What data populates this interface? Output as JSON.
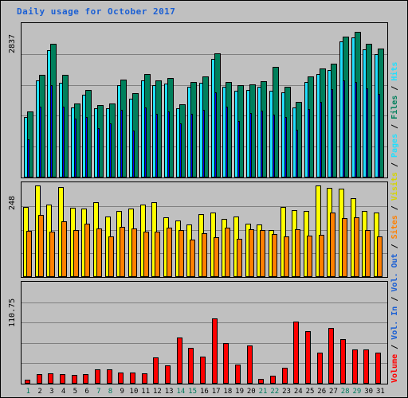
{
  "title": "Daily usage for October 2017",
  "colors": {
    "title": "#1a5fd4",
    "background": "#c0c0c0",
    "hits": "#20e0ff",
    "files": "#00805c",
    "pages": "#0000ff",
    "visits": "#ffff00",
    "sites": "#ff8000",
    "volume": "#ff0000",
    "weekend_label": "#007a5e",
    "weekday_label": "#000000",
    "gridline": "#808080",
    "axis": "#000000"
  },
  "axes": {
    "hits_max_label": "2837",
    "sites_max_label": "248",
    "volume_max_label": "110.75"
  },
  "legend": {
    "text": "Volume / Vol. In / Vol. Out / Sites / Visits / Pages / Files / Hits",
    "items": [
      {
        "label": "Volume",
        "color": "#ff0000"
      },
      {
        "label": "Vol. In",
        "color": "#1a5fd4"
      },
      {
        "label": "Vol. Out",
        "color": "#1a5fd4"
      },
      {
        "label": "Sites",
        "color": "#ff8000"
      },
      {
        "label": "Visits",
        "color": "#d4d400"
      },
      {
        "label": "Pages",
        "color": "#20e0ff"
      },
      {
        "label": "Files",
        "color": "#00805c"
      },
      {
        "label": "Hits",
        "color": "#20e0ff"
      }
    ]
  },
  "days": [
    1,
    2,
    3,
    4,
    5,
    6,
    7,
    8,
    9,
    10,
    11,
    12,
    13,
    14,
    15,
    16,
    17,
    18,
    19,
    20,
    21,
    22,
    23,
    24,
    25,
    26,
    27,
    28,
    29,
    30,
    31
  ],
  "weekend_days": [
    1,
    7,
    8,
    14,
    15,
    21,
    22,
    28,
    29
  ],
  "chart_data": [
    {
      "type": "bar",
      "title": "Daily usage for October 2017 - Hits / Files / Pages",
      "xlabel": "",
      "ylabel": "Hits / Files / Pages",
      "ylim": [
        0,
        2837
      ],
      "grid": true,
      "categories": [
        1,
        2,
        3,
        4,
        5,
        6,
        7,
        8,
        9,
        10,
        11,
        12,
        13,
        14,
        15,
        16,
        17,
        18,
        19,
        20,
        21,
        22,
        23,
        24,
        25,
        26,
        27,
        28,
        29,
        30,
        31
      ],
      "series": [
        {
          "name": "Hits",
          "color": "#20e0ff",
          "values": [
            1120,
            1800,
            2360,
            1760,
            1300,
            1530,
            1290,
            1280,
            1720,
            1470,
            1810,
            1710,
            1740,
            1280,
            1680,
            1760,
            2200,
            1680,
            1610,
            1630,
            1680,
            1610,
            1580,
            1300,
            1780,
            1920,
            2000,
            2520,
            2600,
            2380,
            2290
          ]
        },
        {
          "name": "Files",
          "color": "#00805c",
          "values": [
            1220,
            1900,
            2480,
            1900,
            1380,
            1630,
            1350,
            1380,
            1820,
            1560,
            1920,
            1810,
            1840,
            1360,
            1780,
            1870,
            2310,
            1780,
            1710,
            1730,
            1790,
            2060,
            1680,
            1400,
            1880,
            2030,
            2110,
            2610,
            2700,
            2480,
            2390
          ]
        },
        {
          "name": "Pages",
          "color": "#0000ff",
          "values": [
            710,
            1310,
            1720,
            1310,
            1090,
            1120,
            910,
            1000,
            1260,
            870,
            1300,
            1180,
            1230,
            1010,
            1180,
            1250,
            1580,
            1320,
            1050,
            1190,
            1240,
            1160,
            1120,
            890,
            1270,
            1400,
            1640,
            1800,
            1780,
            1660,
            1550
          ]
        }
      ]
    },
    {
      "type": "bar",
      "title": "Daily usage for October 2017 - Sites / Visits",
      "xlabel": "",
      "ylabel": "Sites / Visits",
      "ylim": [
        0,
        248
      ],
      "grid": true,
      "categories": [
        1,
        2,
        3,
        4,
        5,
        6,
        7,
        8,
        9,
        10,
        11,
        12,
        13,
        14,
        15,
        16,
        17,
        18,
        19,
        20,
        21,
        22,
        23,
        24,
        25,
        26,
        27,
        28,
        29,
        30,
        31
      ],
      "series": [
        {
          "name": "Visits",
          "color": "#ffff00",
          "values": [
            186,
            243,
            193,
            240,
            184,
            182,
            199,
            161,
            176,
            182,
            192,
            199,
            158,
            150,
            140,
            168,
            172,
            155,
            161,
            143,
            139,
            125,
            186,
            178,
            176,
            243,
            237,
            235,
            209,
            176,
            171
          ]
        },
        {
          "name": "Sites",
          "color": "#ff8000",
          "values": [
            122,
            165,
            120,
            148,
            125,
            142,
            129,
            108,
            133,
            130,
            120,
            120,
            131,
            126,
            100,
            117,
            107,
            132,
            102,
            127,
            124,
            115,
            109,
            128,
            111,
            112,
            172,
            157,
            158,
            126,
            109
          ]
        }
      ]
    },
    {
      "type": "bar",
      "title": "Daily usage for October 2017 - Volume (KB)",
      "xlabel": "",
      "ylabel": "Volume",
      "ylim": [
        0,
        110.75
      ],
      "grid": true,
      "categories": [
        1,
        2,
        3,
        4,
        5,
        6,
        7,
        8,
        9,
        10,
        11,
        12,
        13,
        14,
        15,
        16,
        17,
        18,
        19,
        20,
        21,
        22,
        23,
        24,
        25,
        26,
        27,
        28,
        29,
        30,
        31
      ],
      "series": [
        {
          "name": "Volume",
          "color": "#ff0000",
          "values": [
            4.2,
            10.2,
            11.8,
            10.8,
            9.5,
            10.6,
            15.8,
            16.0,
            12.1,
            12.2,
            11.2,
            29.4,
            19.8,
            50.8,
            39.4,
            29.8,
            72.0,
            45.0,
            21.0,
            42.2,
            5.6,
            9.1,
            17.2,
            68.5,
            57.6,
            34.0,
            61.6,
            49.0,
            37.4,
            38.0,
            34.2
          ]
        }
      ]
    }
  ]
}
